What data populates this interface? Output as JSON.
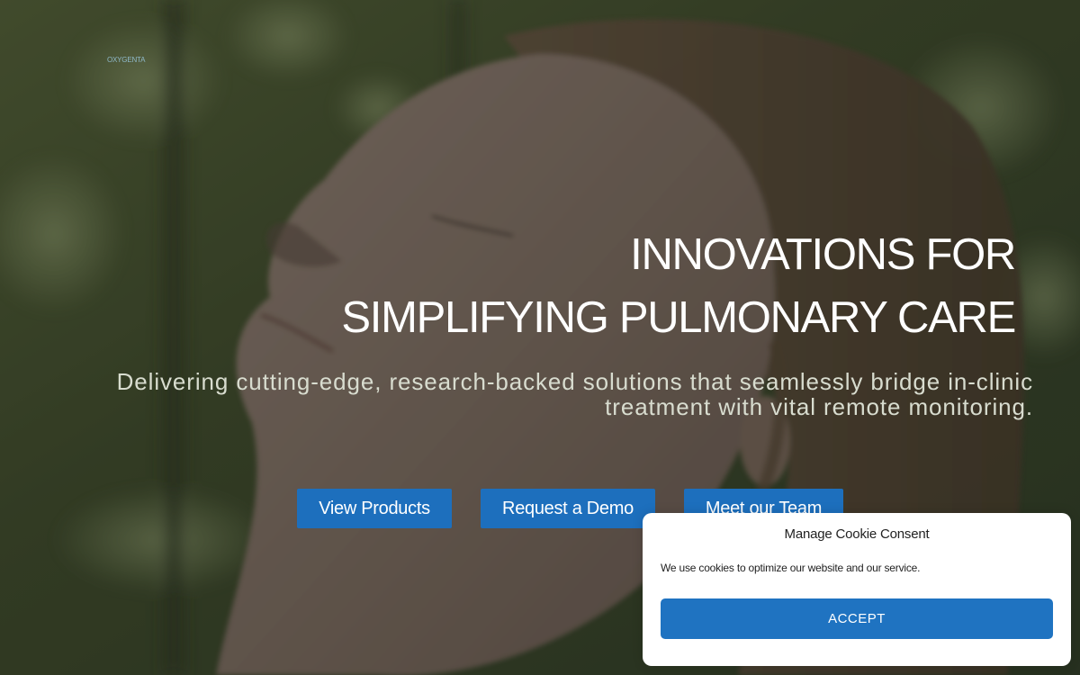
{
  "brand": {
    "logo_text": "OXYGENTA"
  },
  "hero": {
    "headline_line1": "INNOVATIONS FOR",
    "headline_line2": "SIMPLIFYING PULMONARY CARE",
    "subheadline": "Delivering cutting-edge, research-backed solutions that seamlessly bridge in-clinic treatment with vital remote monitoring.",
    "buttons": [
      {
        "label": "View Products"
      },
      {
        "label": "Request a Demo"
      },
      {
        "label": "Meet our Team"
      }
    ]
  },
  "cookie_banner": {
    "title": "Manage Cookie Consent",
    "text": "We use cookies to optimize our website and our service.",
    "accept_label": "ACCEPT"
  },
  "colors": {
    "button_blue": "#1d6fbd",
    "accept_blue": "#1f73c1"
  }
}
